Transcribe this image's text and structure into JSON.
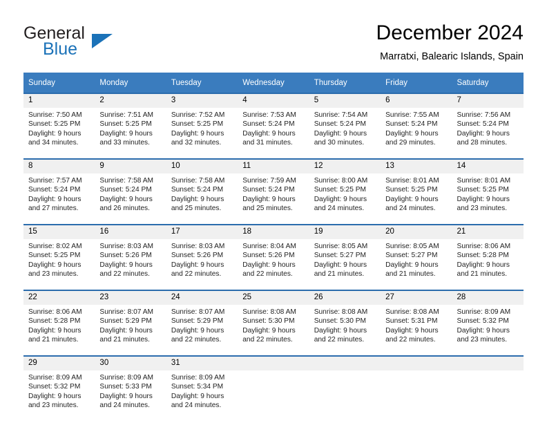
{
  "brand": {
    "name_part1": "General",
    "name_part2": "Blue",
    "logo_icon": "triangle-flag-icon"
  },
  "header": {
    "title": "December 2024",
    "location": "Marratxi, Balearic Islands, Spain"
  },
  "calendar": {
    "weekday_headers": [
      "Sunday",
      "Monday",
      "Tuesday",
      "Wednesday",
      "Thursday",
      "Friday",
      "Saturday"
    ],
    "accent_color": "#3a7cbe",
    "separator_color": "#2b6cad",
    "daynum_bg": "#f0f0f0",
    "weeks": [
      {
        "days": [
          {
            "num": "1",
            "sunrise": "Sunrise: 7:50 AM",
            "sunset": "Sunset: 5:25 PM",
            "daylight1": "Daylight: 9 hours",
            "daylight2": "and 34 minutes."
          },
          {
            "num": "2",
            "sunrise": "Sunrise: 7:51 AM",
            "sunset": "Sunset: 5:25 PM",
            "daylight1": "Daylight: 9 hours",
            "daylight2": "and 33 minutes."
          },
          {
            "num": "3",
            "sunrise": "Sunrise: 7:52 AM",
            "sunset": "Sunset: 5:25 PM",
            "daylight1": "Daylight: 9 hours",
            "daylight2": "and 32 minutes."
          },
          {
            "num": "4",
            "sunrise": "Sunrise: 7:53 AM",
            "sunset": "Sunset: 5:24 PM",
            "daylight1": "Daylight: 9 hours",
            "daylight2": "and 31 minutes."
          },
          {
            "num": "5",
            "sunrise": "Sunrise: 7:54 AM",
            "sunset": "Sunset: 5:24 PM",
            "daylight1": "Daylight: 9 hours",
            "daylight2": "and 30 minutes."
          },
          {
            "num": "6",
            "sunrise": "Sunrise: 7:55 AM",
            "sunset": "Sunset: 5:24 PM",
            "daylight1": "Daylight: 9 hours",
            "daylight2": "and 29 minutes."
          },
          {
            "num": "7",
            "sunrise": "Sunrise: 7:56 AM",
            "sunset": "Sunset: 5:24 PM",
            "daylight1": "Daylight: 9 hours",
            "daylight2": "and 28 minutes."
          }
        ]
      },
      {
        "days": [
          {
            "num": "8",
            "sunrise": "Sunrise: 7:57 AM",
            "sunset": "Sunset: 5:24 PM",
            "daylight1": "Daylight: 9 hours",
            "daylight2": "and 27 minutes."
          },
          {
            "num": "9",
            "sunrise": "Sunrise: 7:58 AM",
            "sunset": "Sunset: 5:24 PM",
            "daylight1": "Daylight: 9 hours",
            "daylight2": "and 26 minutes."
          },
          {
            "num": "10",
            "sunrise": "Sunrise: 7:58 AM",
            "sunset": "Sunset: 5:24 PM",
            "daylight1": "Daylight: 9 hours",
            "daylight2": "and 25 minutes."
          },
          {
            "num": "11",
            "sunrise": "Sunrise: 7:59 AM",
            "sunset": "Sunset: 5:24 PM",
            "daylight1": "Daylight: 9 hours",
            "daylight2": "and 25 minutes."
          },
          {
            "num": "12",
            "sunrise": "Sunrise: 8:00 AM",
            "sunset": "Sunset: 5:25 PM",
            "daylight1": "Daylight: 9 hours",
            "daylight2": "and 24 minutes."
          },
          {
            "num": "13",
            "sunrise": "Sunrise: 8:01 AM",
            "sunset": "Sunset: 5:25 PM",
            "daylight1": "Daylight: 9 hours",
            "daylight2": "and 24 minutes."
          },
          {
            "num": "14",
            "sunrise": "Sunrise: 8:01 AM",
            "sunset": "Sunset: 5:25 PM",
            "daylight1": "Daylight: 9 hours",
            "daylight2": "and 23 minutes."
          }
        ]
      },
      {
        "days": [
          {
            "num": "15",
            "sunrise": "Sunrise: 8:02 AM",
            "sunset": "Sunset: 5:25 PM",
            "daylight1": "Daylight: 9 hours",
            "daylight2": "and 23 minutes."
          },
          {
            "num": "16",
            "sunrise": "Sunrise: 8:03 AM",
            "sunset": "Sunset: 5:26 PM",
            "daylight1": "Daylight: 9 hours",
            "daylight2": "and 22 minutes."
          },
          {
            "num": "17",
            "sunrise": "Sunrise: 8:03 AM",
            "sunset": "Sunset: 5:26 PM",
            "daylight1": "Daylight: 9 hours",
            "daylight2": "and 22 minutes."
          },
          {
            "num": "18",
            "sunrise": "Sunrise: 8:04 AM",
            "sunset": "Sunset: 5:26 PM",
            "daylight1": "Daylight: 9 hours",
            "daylight2": "and 22 minutes."
          },
          {
            "num": "19",
            "sunrise": "Sunrise: 8:05 AM",
            "sunset": "Sunset: 5:27 PM",
            "daylight1": "Daylight: 9 hours",
            "daylight2": "and 21 minutes."
          },
          {
            "num": "20",
            "sunrise": "Sunrise: 8:05 AM",
            "sunset": "Sunset: 5:27 PM",
            "daylight1": "Daylight: 9 hours",
            "daylight2": "and 21 minutes."
          },
          {
            "num": "21",
            "sunrise": "Sunrise: 8:06 AM",
            "sunset": "Sunset: 5:28 PM",
            "daylight1": "Daylight: 9 hours",
            "daylight2": "and 21 minutes."
          }
        ]
      },
      {
        "days": [
          {
            "num": "22",
            "sunrise": "Sunrise: 8:06 AM",
            "sunset": "Sunset: 5:28 PM",
            "daylight1": "Daylight: 9 hours",
            "daylight2": "and 21 minutes."
          },
          {
            "num": "23",
            "sunrise": "Sunrise: 8:07 AM",
            "sunset": "Sunset: 5:29 PM",
            "daylight1": "Daylight: 9 hours",
            "daylight2": "and 21 minutes."
          },
          {
            "num": "24",
            "sunrise": "Sunrise: 8:07 AM",
            "sunset": "Sunset: 5:29 PM",
            "daylight1": "Daylight: 9 hours",
            "daylight2": "and 22 minutes."
          },
          {
            "num": "25",
            "sunrise": "Sunrise: 8:08 AM",
            "sunset": "Sunset: 5:30 PM",
            "daylight1": "Daylight: 9 hours",
            "daylight2": "and 22 minutes."
          },
          {
            "num": "26",
            "sunrise": "Sunrise: 8:08 AM",
            "sunset": "Sunset: 5:30 PM",
            "daylight1": "Daylight: 9 hours",
            "daylight2": "and 22 minutes."
          },
          {
            "num": "27",
            "sunrise": "Sunrise: 8:08 AM",
            "sunset": "Sunset: 5:31 PM",
            "daylight1": "Daylight: 9 hours",
            "daylight2": "and 22 minutes."
          },
          {
            "num": "28",
            "sunrise": "Sunrise: 8:09 AM",
            "sunset": "Sunset: 5:32 PM",
            "daylight1": "Daylight: 9 hours",
            "daylight2": "and 23 minutes."
          }
        ]
      },
      {
        "days": [
          {
            "num": "29",
            "sunrise": "Sunrise: 8:09 AM",
            "sunset": "Sunset: 5:32 PM",
            "daylight1": "Daylight: 9 hours",
            "daylight2": "and 23 minutes."
          },
          {
            "num": "30",
            "sunrise": "Sunrise: 8:09 AM",
            "sunset": "Sunset: 5:33 PM",
            "daylight1": "Daylight: 9 hours",
            "daylight2": "and 24 minutes."
          },
          {
            "num": "31",
            "sunrise": "Sunrise: 8:09 AM",
            "sunset": "Sunset: 5:34 PM",
            "daylight1": "Daylight: 9 hours",
            "daylight2": "and 24 minutes."
          },
          {
            "num": "",
            "sunrise": "",
            "sunset": "",
            "daylight1": "",
            "daylight2": ""
          },
          {
            "num": "",
            "sunrise": "",
            "sunset": "",
            "daylight1": "",
            "daylight2": ""
          },
          {
            "num": "",
            "sunrise": "",
            "sunset": "",
            "daylight1": "",
            "daylight2": ""
          },
          {
            "num": "",
            "sunrise": "",
            "sunset": "",
            "daylight1": "",
            "daylight2": ""
          }
        ]
      }
    ]
  }
}
